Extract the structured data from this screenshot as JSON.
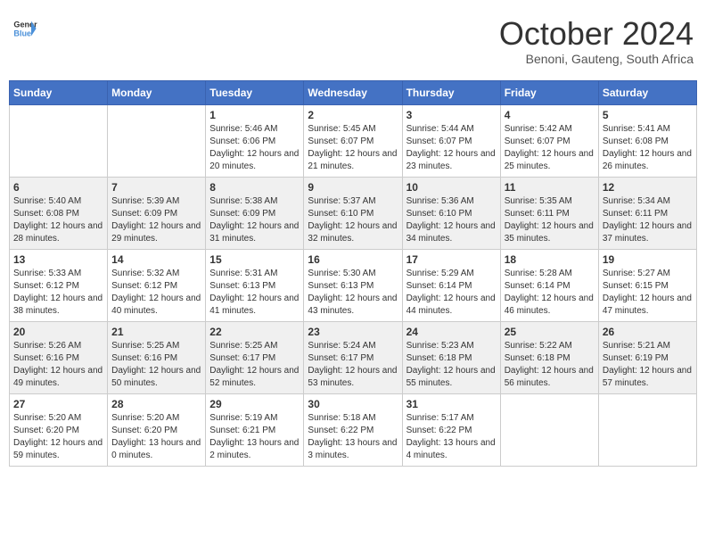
{
  "header": {
    "logo_general": "General",
    "logo_blue": "Blue",
    "month_title": "October 2024",
    "subtitle": "Benoni, Gauteng, South Africa"
  },
  "days_of_week": [
    "Sunday",
    "Monday",
    "Tuesday",
    "Wednesday",
    "Thursday",
    "Friday",
    "Saturday"
  ],
  "weeks": [
    [
      {
        "day": "",
        "sunrise": "",
        "sunset": "",
        "daylight": ""
      },
      {
        "day": "",
        "sunrise": "",
        "sunset": "",
        "daylight": ""
      },
      {
        "day": "1",
        "sunrise": "Sunrise: 5:46 AM",
        "sunset": "Sunset: 6:06 PM",
        "daylight": "Daylight: 12 hours and 20 minutes."
      },
      {
        "day": "2",
        "sunrise": "Sunrise: 5:45 AM",
        "sunset": "Sunset: 6:07 PM",
        "daylight": "Daylight: 12 hours and 21 minutes."
      },
      {
        "day": "3",
        "sunrise": "Sunrise: 5:44 AM",
        "sunset": "Sunset: 6:07 PM",
        "daylight": "Daylight: 12 hours and 23 minutes."
      },
      {
        "day": "4",
        "sunrise": "Sunrise: 5:42 AM",
        "sunset": "Sunset: 6:07 PM",
        "daylight": "Daylight: 12 hours and 25 minutes."
      },
      {
        "day": "5",
        "sunrise": "Sunrise: 5:41 AM",
        "sunset": "Sunset: 6:08 PM",
        "daylight": "Daylight: 12 hours and 26 minutes."
      }
    ],
    [
      {
        "day": "6",
        "sunrise": "Sunrise: 5:40 AM",
        "sunset": "Sunset: 6:08 PM",
        "daylight": "Daylight: 12 hours and 28 minutes."
      },
      {
        "day": "7",
        "sunrise": "Sunrise: 5:39 AM",
        "sunset": "Sunset: 6:09 PM",
        "daylight": "Daylight: 12 hours and 29 minutes."
      },
      {
        "day": "8",
        "sunrise": "Sunrise: 5:38 AM",
        "sunset": "Sunset: 6:09 PM",
        "daylight": "Daylight: 12 hours and 31 minutes."
      },
      {
        "day": "9",
        "sunrise": "Sunrise: 5:37 AM",
        "sunset": "Sunset: 6:10 PM",
        "daylight": "Daylight: 12 hours and 32 minutes."
      },
      {
        "day": "10",
        "sunrise": "Sunrise: 5:36 AM",
        "sunset": "Sunset: 6:10 PM",
        "daylight": "Daylight: 12 hours and 34 minutes."
      },
      {
        "day": "11",
        "sunrise": "Sunrise: 5:35 AM",
        "sunset": "Sunset: 6:11 PM",
        "daylight": "Daylight: 12 hours and 35 minutes."
      },
      {
        "day": "12",
        "sunrise": "Sunrise: 5:34 AM",
        "sunset": "Sunset: 6:11 PM",
        "daylight": "Daylight: 12 hours and 37 minutes."
      }
    ],
    [
      {
        "day": "13",
        "sunrise": "Sunrise: 5:33 AM",
        "sunset": "Sunset: 6:12 PM",
        "daylight": "Daylight: 12 hours and 38 minutes."
      },
      {
        "day": "14",
        "sunrise": "Sunrise: 5:32 AM",
        "sunset": "Sunset: 6:12 PM",
        "daylight": "Daylight: 12 hours and 40 minutes."
      },
      {
        "day": "15",
        "sunrise": "Sunrise: 5:31 AM",
        "sunset": "Sunset: 6:13 PM",
        "daylight": "Daylight: 12 hours and 41 minutes."
      },
      {
        "day": "16",
        "sunrise": "Sunrise: 5:30 AM",
        "sunset": "Sunset: 6:13 PM",
        "daylight": "Daylight: 12 hours and 43 minutes."
      },
      {
        "day": "17",
        "sunrise": "Sunrise: 5:29 AM",
        "sunset": "Sunset: 6:14 PM",
        "daylight": "Daylight: 12 hours and 44 minutes."
      },
      {
        "day": "18",
        "sunrise": "Sunrise: 5:28 AM",
        "sunset": "Sunset: 6:14 PM",
        "daylight": "Daylight: 12 hours and 46 minutes."
      },
      {
        "day": "19",
        "sunrise": "Sunrise: 5:27 AM",
        "sunset": "Sunset: 6:15 PM",
        "daylight": "Daylight: 12 hours and 47 minutes."
      }
    ],
    [
      {
        "day": "20",
        "sunrise": "Sunrise: 5:26 AM",
        "sunset": "Sunset: 6:16 PM",
        "daylight": "Daylight: 12 hours and 49 minutes."
      },
      {
        "day": "21",
        "sunrise": "Sunrise: 5:25 AM",
        "sunset": "Sunset: 6:16 PM",
        "daylight": "Daylight: 12 hours and 50 minutes."
      },
      {
        "day": "22",
        "sunrise": "Sunrise: 5:25 AM",
        "sunset": "Sunset: 6:17 PM",
        "daylight": "Daylight: 12 hours and 52 minutes."
      },
      {
        "day": "23",
        "sunrise": "Sunrise: 5:24 AM",
        "sunset": "Sunset: 6:17 PM",
        "daylight": "Daylight: 12 hours and 53 minutes."
      },
      {
        "day": "24",
        "sunrise": "Sunrise: 5:23 AM",
        "sunset": "Sunset: 6:18 PM",
        "daylight": "Daylight: 12 hours and 55 minutes."
      },
      {
        "day": "25",
        "sunrise": "Sunrise: 5:22 AM",
        "sunset": "Sunset: 6:18 PM",
        "daylight": "Daylight: 12 hours and 56 minutes."
      },
      {
        "day": "26",
        "sunrise": "Sunrise: 5:21 AM",
        "sunset": "Sunset: 6:19 PM",
        "daylight": "Daylight: 12 hours and 57 minutes."
      }
    ],
    [
      {
        "day": "27",
        "sunrise": "Sunrise: 5:20 AM",
        "sunset": "Sunset: 6:20 PM",
        "daylight": "Daylight: 12 hours and 59 minutes."
      },
      {
        "day": "28",
        "sunrise": "Sunrise: 5:20 AM",
        "sunset": "Sunset: 6:20 PM",
        "daylight": "Daylight: 13 hours and 0 minutes."
      },
      {
        "day": "29",
        "sunrise": "Sunrise: 5:19 AM",
        "sunset": "Sunset: 6:21 PM",
        "daylight": "Daylight: 13 hours and 2 minutes."
      },
      {
        "day": "30",
        "sunrise": "Sunrise: 5:18 AM",
        "sunset": "Sunset: 6:22 PM",
        "daylight": "Daylight: 13 hours and 3 minutes."
      },
      {
        "day": "31",
        "sunrise": "Sunrise: 5:17 AM",
        "sunset": "Sunset: 6:22 PM",
        "daylight": "Daylight: 13 hours and 4 minutes."
      },
      {
        "day": "",
        "sunrise": "",
        "sunset": "",
        "daylight": ""
      },
      {
        "day": "",
        "sunrise": "",
        "sunset": "",
        "daylight": ""
      }
    ]
  ]
}
